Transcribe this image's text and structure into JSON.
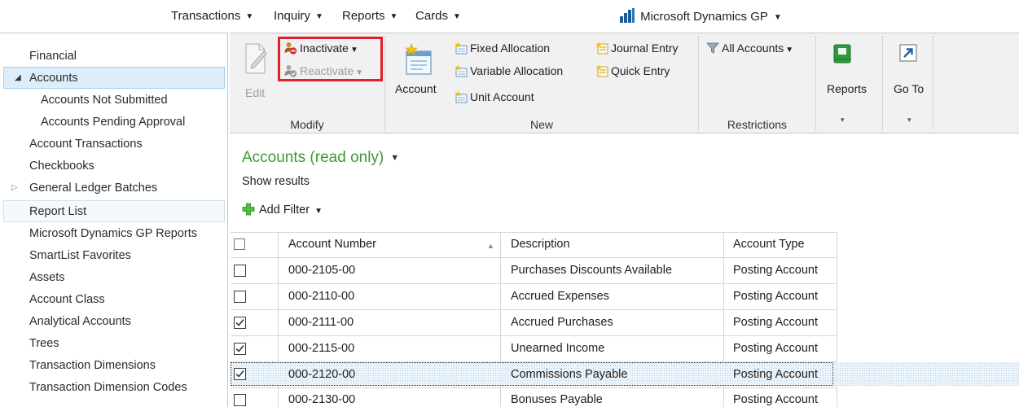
{
  "top_menu": {
    "items": [
      "Transactions",
      "Inquiry",
      "Reports",
      "Cards"
    ],
    "product": "Microsoft Dynamics GP"
  },
  "sidebar": {
    "items": [
      {
        "label": "Financial"
      },
      {
        "label": "Accounts",
        "expanded": true,
        "selected": true
      },
      {
        "label": "Accounts Not Submitted"
      },
      {
        "label": "Accounts Pending Approval"
      },
      {
        "label": "Account Transactions"
      },
      {
        "label": "Checkbooks"
      },
      {
        "label": "General Ledger Batches",
        "expandable": true
      },
      {
        "label": "Report List"
      },
      {
        "label": "Microsoft Dynamics GP Reports"
      },
      {
        "label": "SmartList Favorites"
      },
      {
        "label": "Assets"
      },
      {
        "label": "Account Class"
      },
      {
        "label": "Analytical Accounts"
      },
      {
        "label": "Trees"
      },
      {
        "label": "Transaction Dimensions"
      },
      {
        "label": "Transaction Dimension Codes"
      }
    ]
  },
  "ribbon": {
    "modify": {
      "label": "Modify",
      "edit": "Edit",
      "inactivate": "Inactivate",
      "reactivate": "Reactivate"
    },
    "new": {
      "label": "New",
      "account": "Account",
      "fixed_allocation": "Fixed Allocation",
      "variable_allocation": "Variable Allocation",
      "unit_account": "Unit Account",
      "journal_entry": "Journal Entry",
      "quick_entry": "Quick Entry"
    },
    "restrictions": {
      "label": "Restrictions",
      "all_accounts": "All Accounts"
    },
    "reports": "Reports",
    "go_to": "Go To"
  },
  "list": {
    "title": "Accounts (read only)",
    "show_results": "Show results",
    "add_filter": "Add Filter",
    "columns": [
      "Account Number",
      "Description",
      "Account Type"
    ],
    "sort_column": "Account Number",
    "rows": [
      {
        "checked": false,
        "account_number": "000-2105-00",
        "description": "Purchases Discounts Available",
        "account_type": "Posting Account"
      },
      {
        "checked": false,
        "account_number": "000-2110-00",
        "description": "Accrued Expenses",
        "account_type": "Posting Account"
      },
      {
        "checked": true,
        "account_number": "000-2111-00",
        "description": "Accrued Purchases",
        "account_type": "Posting Account"
      },
      {
        "checked": true,
        "account_number": "000-2115-00",
        "description": "Unearned Income",
        "account_type": "Posting Account"
      },
      {
        "checked": true,
        "account_number": "000-2120-00",
        "description": "Commissions Payable",
        "account_type": "Posting Account",
        "focused": true
      },
      {
        "checked": false,
        "account_number": "000-2130-00",
        "description": "Bonuses Payable",
        "account_type": "Posting Account"
      }
    ]
  },
  "colors": {
    "view_title": "#3d9a34",
    "highlight_box": "#e0202a",
    "selection": "#ddeefa"
  }
}
